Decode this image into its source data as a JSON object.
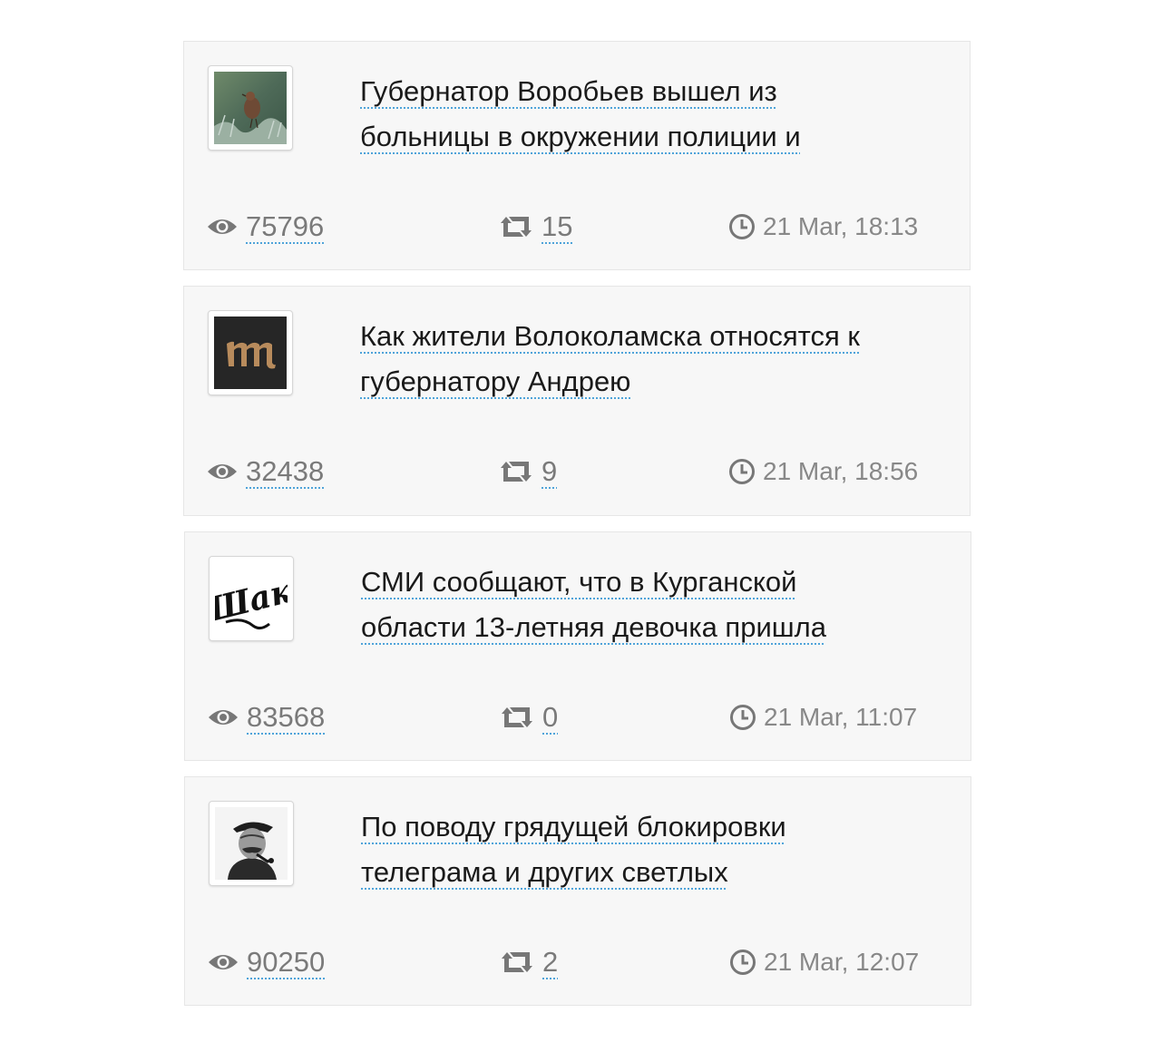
{
  "posts": [
    {
      "avatar_icon": "bird-photo-avatar",
      "title": "Губернатор Воробьев вышел из больницы в окружении полиции и",
      "views": "75796",
      "shares": "15",
      "date": "21 Mar, 18:13"
    },
    {
      "avatar_icon": "medusa-m-logo-avatar",
      "title": "Как жители Волоколамска относятся к губернатору Андрею",
      "views": "32438",
      "shares": "9",
      "date": "21 Mar, 18:56"
    },
    {
      "avatar_icon": "script-logo-avatar",
      "avatar_text": "Шак",
      "title": "СМИ сообщают, что в Курганской области 13-летняя девочка пришла",
      "views": "83568",
      "shares": "0",
      "date": "21 Mar, 11:07"
    },
    {
      "avatar_icon": "portrait-photo-avatar",
      "title": "По поводу грядущей блокировки телеграма и других светлых",
      "views": "90250",
      "shares": "2",
      "date": "21 Mar, 12:07"
    }
  ],
  "colors": {
    "card_bg": "#f7f7f7",
    "link_underline": "#4fa3d9",
    "stat_text": "#7a7a7a"
  }
}
